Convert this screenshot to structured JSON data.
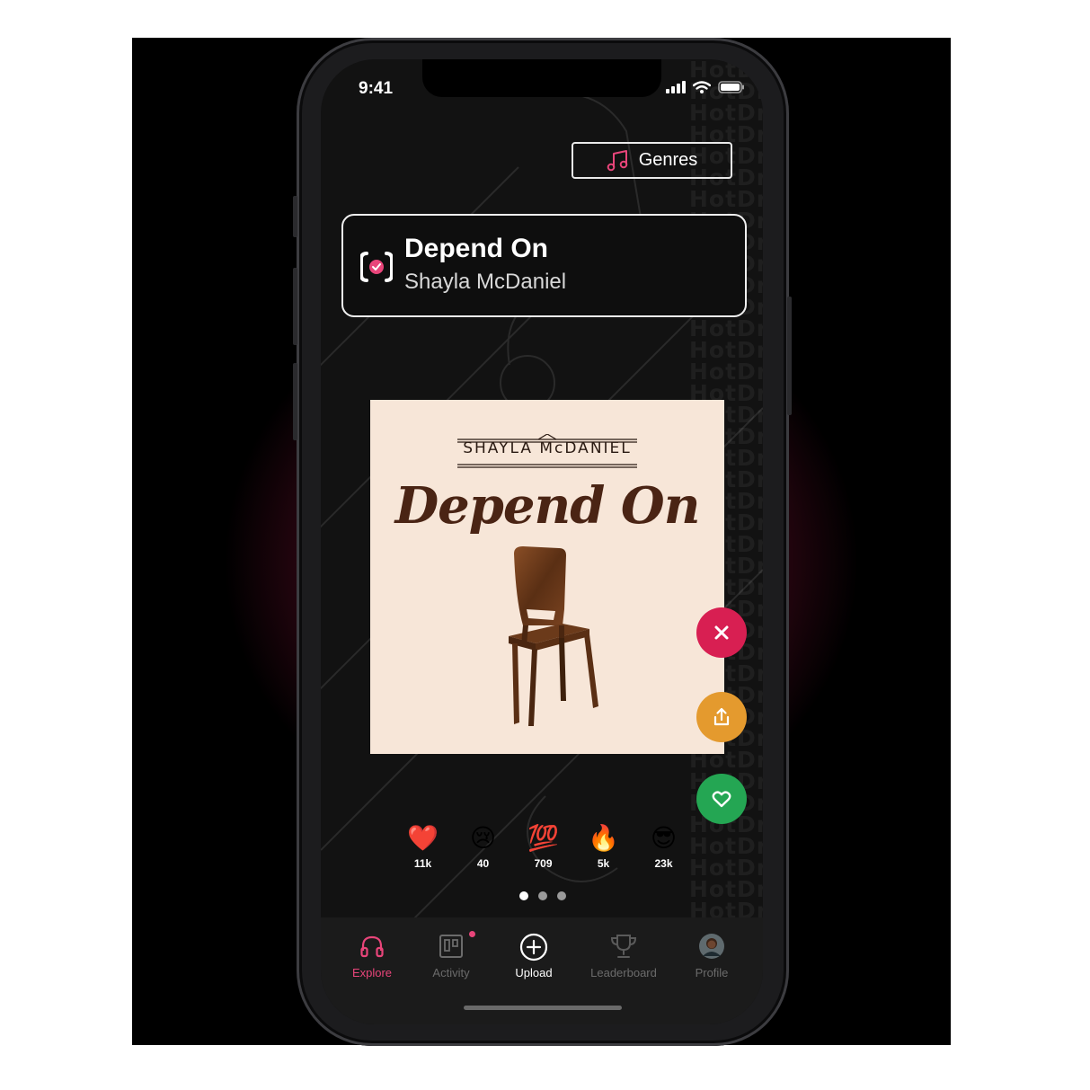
{
  "status_bar": {
    "time": "9:41"
  },
  "genres_button": {
    "label": "Genres",
    "icon": "music-note-icon"
  },
  "now_playing": {
    "title": "Depend On",
    "artist": "Shayla McDaniel",
    "logo_icon": "hotdrop-logo-icon"
  },
  "cover_art": {
    "artist": "SHAYLA McDANIEL",
    "title": "Depend On",
    "image": "wooden-chair"
  },
  "watermark": "HotDrop",
  "actions": [
    {
      "name": "dismiss",
      "icon": "close-icon",
      "color": "#d81f52"
    },
    {
      "name": "share",
      "icon": "share-icon",
      "color": "#e49a2e"
    },
    {
      "name": "like",
      "icon": "heart-icon",
      "color": "#24a653"
    }
  ],
  "reactions": [
    {
      "emoji": "❤️",
      "count": "11k"
    },
    {
      "emoji": "😢",
      "count": "40"
    },
    {
      "emoji": "💯",
      "count": "709"
    },
    {
      "emoji": "🔥",
      "count": "5k"
    },
    {
      "emoji": "😎",
      "count": "23k"
    }
  ],
  "pagination": {
    "total": 3,
    "active": 1
  },
  "tabs": [
    {
      "label": "Explore",
      "icon": "headphones-icon",
      "active": true
    },
    {
      "label": "Activity",
      "icon": "activity-board-icon",
      "badge": true
    },
    {
      "label": "Upload",
      "icon": "plus-circle-icon"
    },
    {
      "label": "Leaderboard",
      "icon": "trophy-icon"
    },
    {
      "label": "Profile",
      "icon": "avatar"
    }
  ],
  "colors": {
    "accent": "#e8457a",
    "background": "#121212"
  }
}
